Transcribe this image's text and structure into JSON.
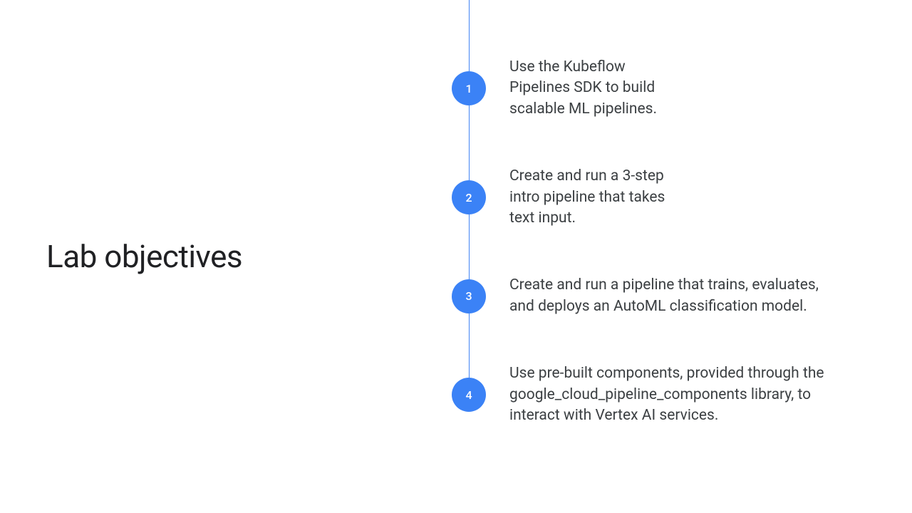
{
  "title": "Lab objectives",
  "colors": {
    "accent": "#3b82f6",
    "line": "#4285f4",
    "text": "#3c4043",
    "title": "#202124"
  },
  "objectives": [
    {
      "number": "1",
      "text": "Use the Kubeflow Pipelines SDK to build scalable ML pipelines."
    },
    {
      "number": "2",
      "text": "Create and run a 3-step intro pipeline that takes text input."
    },
    {
      "number": "3",
      "text": "Create and run a pipeline that trains, evaluates, and deploys an AutoML classification model."
    },
    {
      "number": "4",
      "text": "Use pre-built components, provided through the google_cloud_pipeline_components library, to interact with Vertex AI services."
    }
  ]
}
